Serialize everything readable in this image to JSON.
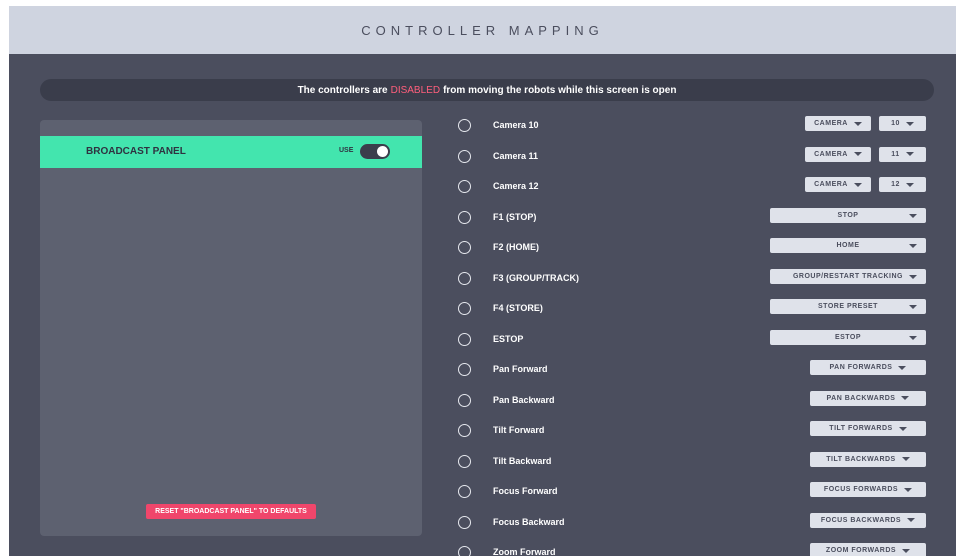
{
  "title": "CONTROLLER MAPPING",
  "banner": {
    "prefix": "The controllers are",
    "status": "DISABLED",
    "suffix": "from moving the robots while this screen is open"
  },
  "panel": {
    "title": "BROADCAST PANEL",
    "use_label": "USE",
    "use_enabled": true,
    "reset_label": "RESET \"BROADCAST PANEL\" TO DEFAULTS"
  },
  "colors": {
    "accent_green": "#43e5ae",
    "danger": "#f0466b",
    "disabled_text": "#ff5f7c"
  },
  "mappings": [
    {
      "label": "Camera 10",
      "action": "CAMERA",
      "number": "10"
    },
    {
      "label": "Camera 11",
      "action": "CAMERA",
      "number": "11"
    },
    {
      "label": "Camera 12",
      "action": "CAMERA",
      "number": "12"
    },
    {
      "label": "F1 (STOP)",
      "action": "STOP"
    },
    {
      "label": "F2 (HOME)",
      "action": "HOME"
    },
    {
      "label": "F3 (GROUP/TRACK)",
      "action": "GROUP/RESTART TRACKING"
    },
    {
      "label": "F4 (STORE)",
      "action": "STORE PRESET"
    },
    {
      "label": "ESTOP",
      "action": "ESTOP"
    },
    {
      "label": "Pan Forward",
      "action": "PAN FORWARDS"
    },
    {
      "label": "Pan Backward",
      "action": "PAN BACKWARDS"
    },
    {
      "label": "Tilt Forward",
      "action": "TILT FORWARDS"
    },
    {
      "label": "Tilt Backward",
      "action": "TILT BACKWARDS"
    },
    {
      "label": "Focus Forward",
      "action": "FOCUS FORWARDS"
    },
    {
      "label": "Focus Backward",
      "action": "FOCUS BACKWARDS"
    },
    {
      "label": "Zoom Forward",
      "action": "ZOOM FORWARDS"
    }
  ]
}
